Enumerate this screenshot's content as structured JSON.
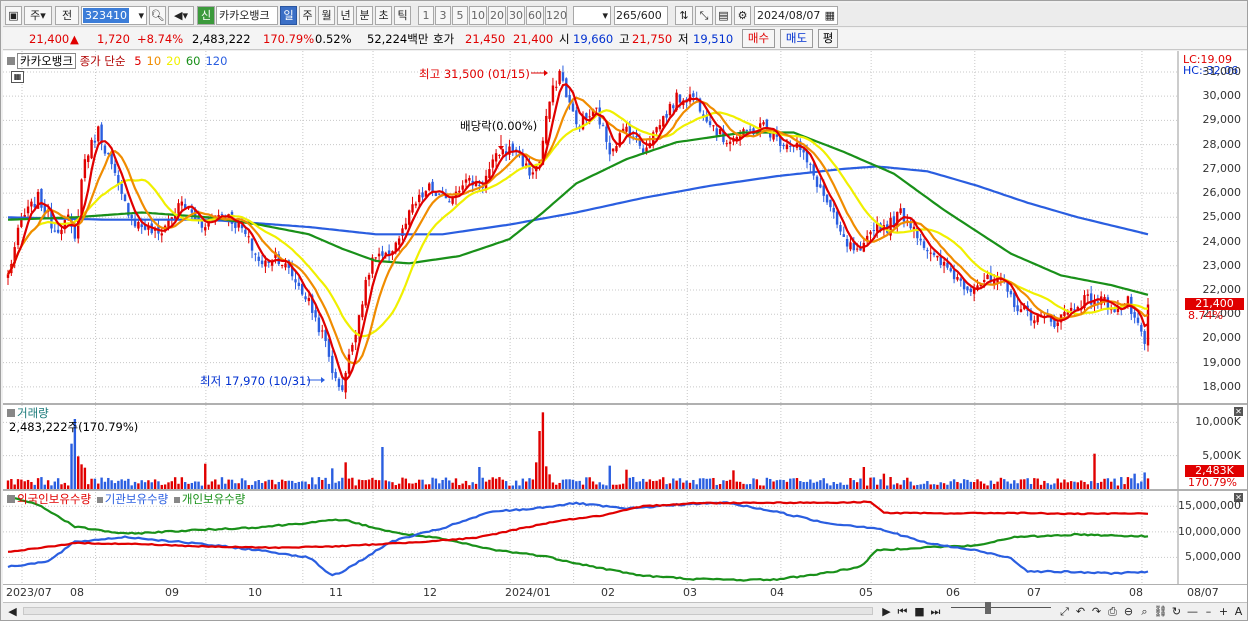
{
  "toolbar": {
    "week_label": "주",
    "prev_label": "전",
    "stock_code": "323410",
    "credit_label": "신",
    "stock_name": "카카오뱅크",
    "periods": [
      "일",
      "주",
      "월",
      "년",
      "분",
      "초",
      "틱"
    ],
    "selected_period": "일",
    "minute_options": [
      "1",
      "3",
      "5",
      "10",
      "20",
      "30",
      "60",
      "120"
    ],
    "count_display": "265",
    "count_max": "/600",
    "date_value": "2024/08/07"
  },
  "summary": {
    "price": "21,400",
    "change_arrow": "▲",
    "change": "1,720",
    "change_pct": "+8.74%",
    "volume": "2,483,222",
    "volume_ratio": "170.79%",
    "turnover": "0.52%",
    "amount": "52,224백만",
    "ask_label": "호가",
    "ask1": "21,450",
    "ask2": "21,400",
    "open_label": "시",
    "open": "19,660",
    "high_label": "고",
    "high": "21,750",
    "low_label": "저",
    "low": "19,510",
    "buy_label": "매수",
    "sell_label": "매도",
    "avg_label": "평"
  },
  "price_pane": {
    "title": "카카오뱅크",
    "indicator_label": "종가 단순",
    "ma_periods": [
      "5",
      "10",
      "20",
      "60",
      "120"
    ],
    "ma_colors": {
      "5": "#e00000",
      "10": "#f08c00",
      "20": "#f0f000",
      "60": "#199019",
      "120": "#2a5ee0"
    },
    "lc_label": "LC:19.09",
    "hc_label": "HC:-32.06",
    "high_annotation": "최고 31,500 (01/15)",
    "low_annotation": "최저 17,970 (10/31)",
    "dividend_annotation": "배당락(0.00%)",
    "y_ticks": [
      "31,000",
      "30,000",
      "29,000",
      "28,000",
      "27,000",
      "26,000",
      "25,000",
      "24,000",
      "23,000",
      "22,000",
      "21,000",
      "20,000",
      "19,000",
      "18,000"
    ],
    "price_tag": "21,400",
    "pct_tag": "8.74%"
  },
  "volume_pane": {
    "title": "거래량",
    "value_label": "2,483,222주(170.79%)",
    "y_ticks": [
      "10,000K",
      "5,000K"
    ],
    "vol_tag": "2,483K",
    "ratio_tag": "170.79%"
  },
  "holdings_pane": {
    "legend": [
      "외국인보유수량",
      "기관보유수량",
      "개인보유수량"
    ],
    "colors": {
      "foreign": "#e00000",
      "institution": "#2a5ee0",
      "individual": "#199019"
    },
    "y_ticks": [
      "15,000,000",
      "10,000,000",
      "5,000,000"
    ]
  },
  "x_axis": {
    "labels": [
      "2023/07",
      "08",
      "09",
      "10",
      "11",
      "12",
      "2024/01",
      "02",
      "03",
      "04",
      "05",
      "06",
      "07",
      "08"
    ],
    "right_label": "08/07"
  },
  "chart_data": {
    "type": "candlestick",
    "price_range": [
      17500,
      31700
    ],
    "volume_range_k": [
      0,
      12000
    ],
    "holdings_range": [
      0,
      17000000
    ],
    "close_anchors": [
      [
        0,
        22600
      ],
      [
        4,
        24900
      ],
      [
        9,
        25800
      ],
      [
        14,
        24500
      ],
      [
        18,
        24900
      ],
      [
        20,
        24000
      ],
      [
        22,
        26500
      ],
      [
        23,
        27400
      ],
      [
        27,
        28600
      ],
      [
        30,
        27500
      ],
      [
        34,
        25800
      ],
      [
        38,
        24800
      ],
      [
        45,
        24300
      ],
      [
        52,
        25600
      ],
      [
        58,
        24700
      ],
      [
        63,
        25200
      ],
      [
        66,
        25000
      ],
      [
        70,
        24500
      ],
      [
        76,
        23000
      ],
      [
        80,
        23500
      ],
      [
        85,
        22600
      ],
      [
        90,
        21500
      ],
      [
        95,
        19800
      ],
      [
        98,
        18200
      ],
      [
        100,
        18000
      ],
      [
        103,
        19800
      ],
      [
        106,
        21600
      ],
      [
        109,
        23300
      ],
      [
        113,
        23300
      ],
      [
        118,
        24400
      ],
      [
        121,
        25400
      ],
      [
        126,
        26200
      ],
      [
        131,
        25600
      ],
      [
        136,
        26500
      ],
      [
        142,
        26400
      ],
      [
        147,
        27700
      ],
      [
        152,
        27800
      ],
      [
        156,
        26800
      ],
      [
        159,
        27300
      ],
      [
        162,
        29800
      ],
      [
        165,
        31000
      ],
      [
        170,
        28800
      ],
      [
        176,
        29400
      ],
      [
        180,
        27800
      ],
      [
        185,
        28700
      ],
      [
        190,
        27800
      ],
      [
        195,
        28900
      ],
      [
        200,
        29900
      ],
      [
        205,
        30000
      ],
      [
        210,
        29000
      ],
      [
        214,
        28200
      ],
      [
        220,
        28400
      ],
      [
        226,
        28800
      ],
      [
        230,
        28200
      ],
      [
        236,
        28000
      ],
      [
        240,
        27000
      ],
      [
        245,
        25600
      ],
      [
        250,
        24000
      ],
      [
        255,
        23400
      ],
      [
        259,
        24700
      ],
      [
        263,
        24600
      ],
      [
        267,
        25200
      ],
      [
        271,
        24600
      ],
      [
        276,
        23400
      ],
      [
        281,
        22900
      ],
      [
        287,
        22100
      ],
      [
        292,
        22400
      ],
      [
        297,
        22300
      ],
      [
        302,
        21300
      ],
      [
        307,
        20900
      ],
      [
        313,
        20700
      ],
      [
        317,
        21100
      ],
      [
        322,
        21600
      ],
      [
        327,
        21600
      ],
      [
        332,
        21200
      ],
      [
        335,
        21500
      ],
      [
        338,
        20400
      ],
      [
        340,
        19700
      ],
      [
        341,
        21400
      ]
    ],
    "ma60_anchors": [
      [
        0,
        24900
      ],
      [
        20,
        25000
      ],
      [
        40,
        25200
      ],
      [
        60,
        25000
      ],
      [
        75,
        24700
      ],
      [
        90,
        24300
      ],
      [
        100,
        23700
      ],
      [
        110,
        23200
      ],
      [
        120,
        23100
      ],
      [
        135,
        23400
      ],
      [
        150,
        24100
      ],
      [
        160,
        25200
      ],
      [
        170,
        26400
      ],
      [
        185,
        27400
      ],
      [
        200,
        28100
      ],
      [
        220,
        28500
      ],
      [
        235,
        28500
      ],
      [
        250,
        27700
      ],
      [
        265,
        26800
      ],
      [
        280,
        25300
      ],
      [
        300,
        23500
      ],
      [
        315,
        22600
      ],
      [
        330,
        22200
      ],
      [
        341,
        21800
      ]
    ],
    "ma120_anchors": [
      [
        0,
        25000
      ],
      [
        30,
        24900
      ],
      [
        60,
        24900
      ],
      [
        90,
        24600
      ],
      [
        110,
        24300
      ],
      [
        130,
        24300
      ],
      [
        150,
        24700
      ],
      [
        170,
        25200
      ],
      [
        190,
        25800
      ],
      [
        210,
        26300
      ],
      [
        230,
        26700
      ],
      [
        250,
        27000
      ],
      [
        260,
        27100
      ],
      [
        275,
        26900
      ],
      [
        290,
        26300
      ],
      [
        305,
        25600
      ],
      [
        320,
        25000
      ],
      [
        341,
        24300
      ]
    ],
    "volume_spike_k": [
      [
        19,
        6800
      ],
      [
        20,
        10500
      ],
      [
        21,
        4900
      ],
      [
        22,
        3700
      ],
      [
        23,
        3200
      ],
      [
        59,
        3800
      ],
      [
        97,
        3100
      ],
      [
        101,
        4000
      ],
      [
        112,
        6300
      ],
      [
        141,
        3300
      ],
      [
        158,
        4000
      ],
      [
        159,
        8700
      ],
      [
        160,
        11500
      ],
      [
        161,
        3400
      ],
      [
        162,
        2200
      ],
      [
        180,
        3500
      ],
      [
        185,
        2900
      ],
      [
        217,
        2800
      ],
      [
        256,
        3300
      ],
      [
        262,
        2300
      ],
      [
        325,
        5300
      ],
      [
        337,
        2300
      ],
      [
        340,
        2483
      ]
    ],
    "foreign_anchors": [
      [
        0,
        6000000
      ],
      [
        20,
        7800000
      ],
      [
        40,
        7600000
      ],
      [
        60,
        7100000
      ],
      [
        80,
        6900000
      ],
      [
        100,
        7200000
      ],
      [
        120,
        7900000
      ],
      [
        140,
        8800000
      ],
      [
        150,
        10200000
      ],
      [
        165,
        12200000
      ],
      [
        178,
        13200000
      ],
      [
        190,
        15000000
      ],
      [
        205,
        15600000
      ],
      [
        225,
        15700000
      ],
      [
        250,
        15700000
      ],
      [
        258,
        15900000
      ],
      [
        262,
        13700000
      ],
      [
        280,
        13600000
      ],
      [
        300,
        13700000
      ],
      [
        320,
        13500000
      ],
      [
        341,
        13600000
      ]
    ],
    "institution_anchors": [
      [
        0,
        3200000
      ],
      [
        12,
        4200000
      ],
      [
        20,
        8000000
      ],
      [
        35,
        9000000
      ],
      [
        55,
        7800000
      ],
      [
        75,
        6400000
      ],
      [
        90,
        5000000
      ],
      [
        97,
        1400000
      ],
      [
        100,
        2200000
      ],
      [
        115,
        8200000
      ],
      [
        130,
        10700000
      ],
      [
        145,
        14000000
      ],
      [
        155,
        14400000
      ],
      [
        170,
        15600000
      ],
      [
        185,
        14500000
      ],
      [
        200,
        15300000
      ],
      [
        215,
        15700000
      ],
      [
        230,
        13900000
      ],
      [
        245,
        11700000
      ],
      [
        260,
        10700000
      ],
      [
        275,
        7800000
      ],
      [
        290,
        6300000
      ],
      [
        300,
        4900000
      ],
      [
        305,
        2300000
      ],
      [
        315,
        2200000
      ],
      [
        330,
        1900000
      ],
      [
        341,
        2200000
      ]
    ],
    "individual_anchors": [
      [
        0,
        17000000
      ],
      [
        10,
        15000000
      ],
      [
        20,
        11000000
      ],
      [
        35,
        9600000
      ],
      [
        55,
        10300000
      ],
      [
        75,
        10900000
      ],
      [
        90,
        11800000
      ],
      [
        100,
        12400000
      ],
      [
        115,
        9900000
      ],
      [
        130,
        8600000
      ],
      [
        145,
        6500000
      ],
      [
        160,
        5300000
      ],
      [
        175,
        3200000
      ],
      [
        190,
        1400000
      ],
      [
        205,
        800000
      ],
      [
        220,
        600000
      ],
      [
        230,
        700000
      ],
      [
        245,
        2000000
      ],
      [
        255,
        3200000
      ],
      [
        260,
        6400000
      ],
      [
        275,
        7000000
      ],
      [
        290,
        7300000
      ],
      [
        300,
        8900000
      ],
      [
        320,
        9500000
      ],
      [
        341,
        9100000
      ]
    ]
  }
}
